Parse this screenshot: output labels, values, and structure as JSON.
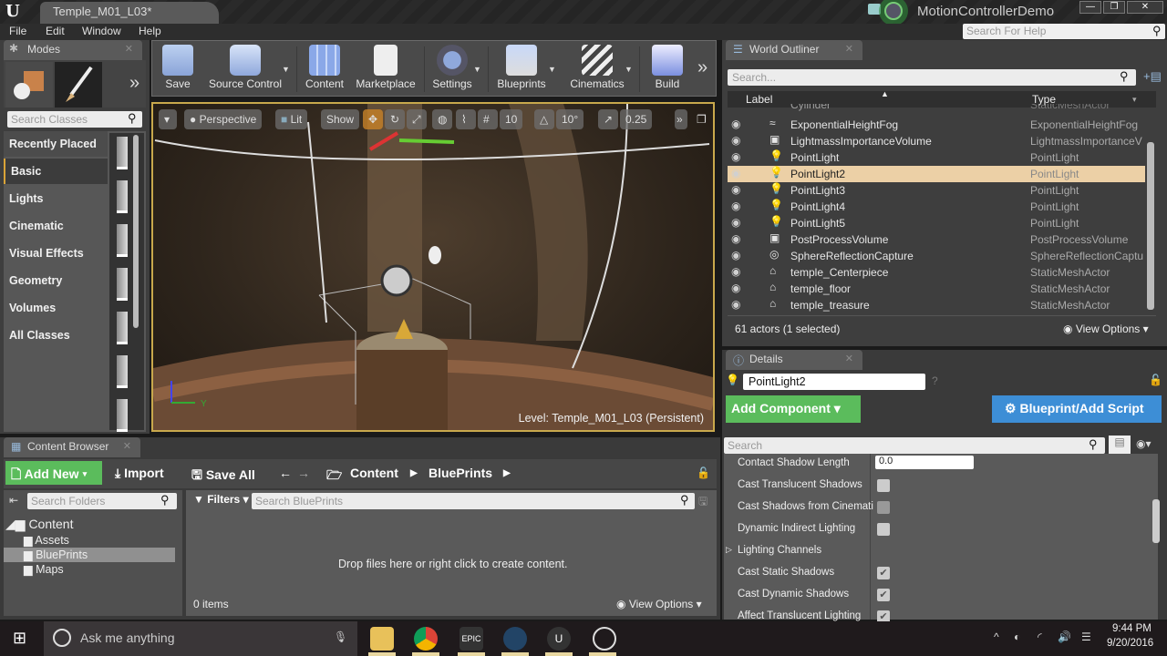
{
  "window": {
    "doc_tab": "Temple_M01_L03*",
    "project": "MotionControllerDemo",
    "controls": {
      "minimize": "—",
      "restore": "❐",
      "close": "✕"
    }
  },
  "menu": [
    "File",
    "Edit",
    "Window",
    "Help"
  ],
  "help_search_placeholder": "Search For Help",
  "modes": {
    "tab": "Modes",
    "search_placeholder": "Search Classes",
    "categories": [
      "Recently Placed",
      "Basic",
      "Lights",
      "Cinematic",
      "Visual Effects",
      "Geometry",
      "Volumes",
      "All Classes"
    ],
    "selected": "Basic"
  },
  "toolbar": {
    "buttons": [
      {
        "label": "Save",
        "icon": "save-icon"
      },
      {
        "label": "Source Control",
        "icon": "source-control-icon"
      },
      {
        "label": "Content",
        "icon": "content-icon"
      },
      {
        "label": "Marketplace",
        "icon": "marketplace-icon"
      },
      {
        "label": "Settings",
        "icon": "settings-icon"
      },
      {
        "label": "Blueprints",
        "icon": "blueprints-icon"
      },
      {
        "label": "Cinematics",
        "icon": "cinematics-icon"
      },
      {
        "label": "Build",
        "icon": "build-icon"
      }
    ],
    "overflow": "»"
  },
  "viewport": {
    "view_mode": "Perspective",
    "lighting": "Lit",
    "show": "Show",
    "grid_snap": "10",
    "rotation_snap": "10°",
    "scale_snap": "0.25",
    "level_label": "Level:  Temple_M01_L03 (Persistent)",
    "axis": {
      "y": "Y"
    }
  },
  "outliner": {
    "tab": "World Outliner",
    "search_placeholder": "Search...",
    "columns": {
      "label": "Label",
      "type": "Type"
    },
    "partial_row": {
      "label": "Cylinder",
      "type": "StaticMeshActor"
    },
    "rows": [
      {
        "label": "ExponentialHeightFog",
        "type": "ExponentialHeightFog",
        "icon": "fog-icon"
      },
      {
        "label": "LightmassImportanceVolume",
        "type": "LightmassImportanceV",
        "icon": "volume-icon"
      },
      {
        "label": "PointLight",
        "type": "PointLight",
        "icon": "lightbulb-icon"
      },
      {
        "label": "PointLight2",
        "type": "PointLight",
        "icon": "lightbulb-icon",
        "selected": true
      },
      {
        "label": "PointLight3",
        "type": "PointLight",
        "icon": "lightbulb-icon"
      },
      {
        "label": "PointLight4",
        "type": "PointLight",
        "icon": "lightbulb-icon"
      },
      {
        "label": "PointLight5",
        "type": "PointLight",
        "icon": "lightbulb-icon"
      },
      {
        "label": "PostProcessVolume",
        "type": "PostProcessVolume",
        "icon": "volume-icon"
      },
      {
        "label": "SphereReflectionCapture",
        "type": "SphereReflectionCaptu",
        "icon": "reflection-capture-icon"
      },
      {
        "label": "temple_Centerpiece",
        "type": "StaticMeshActor",
        "icon": "static-mesh-icon"
      },
      {
        "label": "temple_floor",
        "type": "StaticMeshActor",
        "icon": "static-mesh-icon"
      },
      {
        "label": "temple_treasure",
        "type": "StaticMeshActor",
        "icon": "static-mesh-icon"
      }
    ],
    "status": "61 actors (1 selected)",
    "view_options": "View Options"
  },
  "details": {
    "tab": "Details",
    "name": "PointLight2",
    "add_component": "Add Component",
    "blueprint_script": "Blueprint/Add Script",
    "search_placeholder": "Search",
    "properties": [
      {
        "label": "Contact Shadow Length",
        "kind": "number",
        "value": "0.0"
      },
      {
        "label": "Cast Translucent Shadows",
        "kind": "checkbox",
        "checked": false
      },
      {
        "label": "Cast Shadows from Cinemati",
        "kind": "checkbox",
        "checked": false,
        "disabled": true
      },
      {
        "label": "Dynamic Indirect Lighting",
        "kind": "checkbox",
        "checked": false
      },
      {
        "label": "Lighting Channels",
        "kind": "group"
      },
      {
        "label": "Cast Static Shadows",
        "kind": "checkbox",
        "checked": true
      },
      {
        "label": "Cast Dynamic Shadows",
        "kind": "checkbox",
        "checked": true
      },
      {
        "label": "Affect Translucent Lighting",
        "kind": "checkbox",
        "checked": true
      }
    ]
  },
  "content_browser": {
    "tab": "Content Browser",
    "add_new": "Add New",
    "import": "Import",
    "save_all": "Save All",
    "breadcrumb": [
      "Content",
      "BluePrints"
    ],
    "search_folders_placeholder": "Search Folders",
    "filters": "Filters",
    "search_assets_placeholder": "Search BluePrints",
    "tree": {
      "root": "Content",
      "children": [
        "Assets",
        "BluePrints",
        "Maps"
      ],
      "selected": "BluePrints"
    },
    "empty_message": "Drop files here or right click to create content.",
    "item_count": "0 items",
    "view_options": "View Options"
  },
  "taskbar": {
    "search_placeholder": "Ask me anything",
    "time": "9:44 PM",
    "date": "9/20/2016",
    "apps": [
      "file-explorer",
      "chrome",
      "epic-games-launcher",
      "vr-app",
      "unreal-editor",
      "obs"
    ]
  },
  "colors": {
    "accent_green": "#5bbc5c",
    "accent_blue": "#3d8ed6",
    "selection": "#ecd0a6",
    "viewport_border": "#c8a84c"
  }
}
